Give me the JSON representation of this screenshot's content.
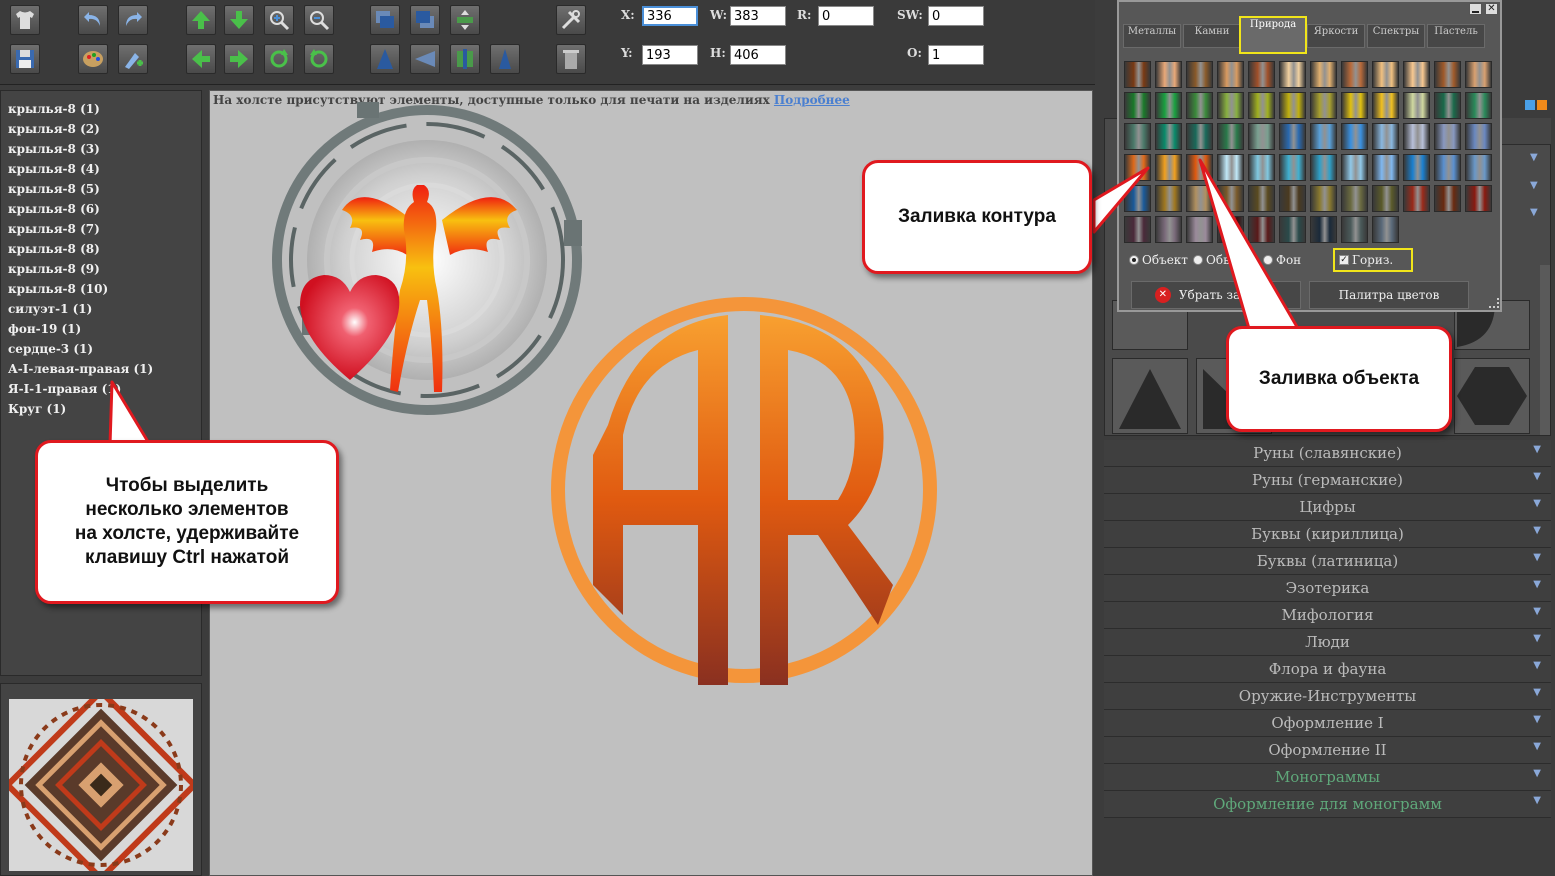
{
  "fields": {
    "x": {
      "label": "X:",
      "value": "336"
    },
    "y": {
      "label": "Y:",
      "value": "193"
    },
    "w": {
      "label": "W:",
      "value": "383"
    },
    "h": {
      "label": "H:",
      "value": "406"
    },
    "r": {
      "label": "R:",
      "value": "0"
    },
    "sw": {
      "label": "SW:",
      "value": "0"
    },
    "o": {
      "label": "O:",
      "value": "1"
    }
  },
  "layers": [
    "крылья-8 (1)",
    "крылья-8 (2)",
    "крылья-8 (3)",
    "крылья-8 (4)",
    "крылья-8 (5)",
    "крылья-8 (6)",
    "крылья-8 (7)",
    "крылья-8 (8)",
    "крылья-8 (9)",
    "крылья-8 (10)",
    "силуэт-1 (1)",
    "фон-19 (1)",
    "сердце-3 (1)",
    "А-I-левая-правая (1)",
    "Я-I-1-правая (1)",
    "Круг (1)"
  ],
  "canvas_notice": {
    "text": "На холсте присутствуют элементы, доступные только для печати на изделиях",
    "link": "Подробнее"
  },
  "palette": {
    "tabs": [
      "Металлы",
      "Камни",
      "Природа",
      "Яркости",
      "Спектры",
      "Пастель"
    ],
    "active_tab": "Природа",
    "options": {
      "object": "Объект",
      "stroke": "Обводк",
      "background": "Фон",
      "horizontal": "Гориз."
    },
    "remove_fill": "Убрать заливку",
    "color_palette": "Палитра цветов",
    "swatch_colors": [
      [
        "#7a3a14",
        "#e8a878",
        "#8a5a2a",
        "#d89a60",
        "#a0502a",
        "#f0d0a0",
        "#e0b070",
        "#b86a3a",
        "#f0c080",
        "#f8c890",
        "#a05a2a",
        "#d8a070"
      ],
      [
        "#1a7a2a",
        "#1aa040",
        "#3a8a3a",
        "#88b040",
        "#a0b020",
        "#c0b010",
        "#a8a030",
        "#e0c010",
        "#f0c020",
        "#d0d8a0",
        "#1a6a4a",
        "#2a8a5a"
      ],
      [
        "#4a7a6a",
        "#0a8a6a",
        "#1a6a5a",
        "#2a7a4a",
        "#7aa090",
        "#2a6ab0",
        "#5aa0d8",
        "#3a90e0",
        "#8ab8e0",
        "#b8c0d8",
        "#8898c0",
        "#6a88c0"
      ],
      [
        "#e06a1a",
        "#f0a020",
        "#e05a10",
        "#c0e8f8",
        "#80c8e0",
        "#40b0d0",
        "#30a0c8",
        "#90c8e8",
        "#80b8f0",
        "#1a80d0",
        "#5a90d0",
        "#6a98c8"
      ],
      [
        "#1a5a9a",
        "#a07820",
        "#b09060",
        "#7a5a2a",
        "#5a4a20",
        "#4a3a20",
        "#8a7a30",
        "#6a6a40",
        "#5a5a2a",
        "#9a2a1a",
        "#6a2a10",
        "#8a1a10"
      ],
      [
        "#4a2a3a",
        "#7a6a7a",
        "#9a8a9a",
        "#3a0a0a",
        "#5a1a1a",
        "#2a4a4a",
        "#1a2a3a",
        "#4a5a5a",
        "#5a6a7a"
      ]
    ]
  },
  "callouts": {
    "contour_fill": "Заливка контура",
    "object_fill": "Заливка объекта",
    "multi_select_lines": [
      "Чтобы выделить",
      "несколько элементов",
      "на холсте, удерживайте",
      "клавишу Ctrl нажатой"
    ]
  },
  "categories": [
    {
      "label": "Руны (славянские)",
      "green": false
    },
    {
      "label": "Руны (германские)",
      "green": false
    },
    {
      "label": "Цифры",
      "green": false
    },
    {
      "label": "Буквы (кириллица)",
      "green": false
    },
    {
      "label": "Буквы (латиница)",
      "green": false
    },
    {
      "label": "Эзотерика",
      "green": false
    },
    {
      "label": "Мифология",
      "green": false
    },
    {
      "label": "Люди",
      "green": false
    },
    {
      "label": "Флора и фауна",
      "green": false
    },
    {
      "label": "Оружие-Инструменты",
      "green": false
    },
    {
      "label": "Оформление I",
      "green": false
    },
    {
      "label": "Оформление II",
      "green": false
    },
    {
      "label": "Монограммы",
      "green": true
    },
    {
      "label": "Оформление для монограмм",
      "green": true
    }
  ],
  "colors": {
    "accent_red": "#e0191f",
    "highlight_yellow": "#f1e51a",
    "link_blue": "#4a7fd0"
  }
}
